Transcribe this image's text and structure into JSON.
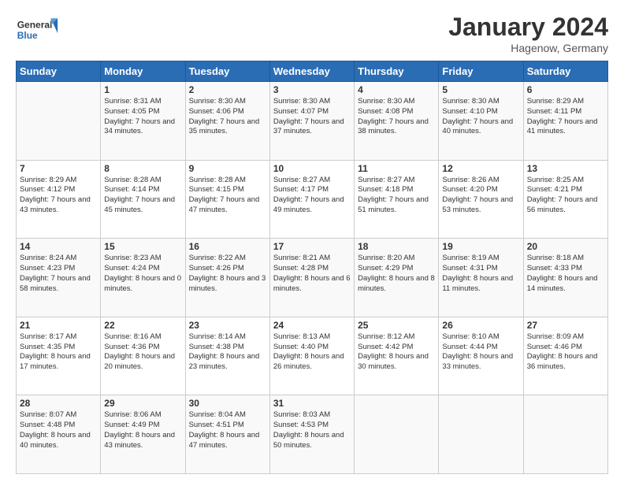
{
  "header": {
    "logo_line1": "General",
    "logo_line2": "Blue",
    "month_title": "January 2024",
    "location": "Hagenow, Germany"
  },
  "days_of_week": [
    "Sunday",
    "Monday",
    "Tuesday",
    "Wednesday",
    "Thursday",
    "Friday",
    "Saturday"
  ],
  "weeks": [
    [
      {
        "day": "",
        "sunrise": "",
        "sunset": "",
        "daylight": ""
      },
      {
        "day": "1",
        "sunrise": "Sunrise: 8:31 AM",
        "sunset": "Sunset: 4:05 PM",
        "daylight": "Daylight: 7 hours and 34 minutes."
      },
      {
        "day": "2",
        "sunrise": "Sunrise: 8:30 AM",
        "sunset": "Sunset: 4:06 PM",
        "daylight": "Daylight: 7 hours and 35 minutes."
      },
      {
        "day": "3",
        "sunrise": "Sunrise: 8:30 AM",
        "sunset": "Sunset: 4:07 PM",
        "daylight": "Daylight: 7 hours and 37 minutes."
      },
      {
        "day": "4",
        "sunrise": "Sunrise: 8:30 AM",
        "sunset": "Sunset: 4:08 PM",
        "daylight": "Daylight: 7 hours and 38 minutes."
      },
      {
        "day": "5",
        "sunrise": "Sunrise: 8:30 AM",
        "sunset": "Sunset: 4:10 PM",
        "daylight": "Daylight: 7 hours and 40 minutes."
      },
      {
        "day": "6",
        "sunrise": "Sunrise: 8:29 AM",
        "sunset": "Sunset: 4:11 PM",
        "daylight": "Daylight: 7 hours and 41 minutes."
      }
    ],
    [
      {
        "day": "7",
        "sunrise": "Sunrise: 8:29 AM",
        "sunset": "Sunset: 4:12 PM",
        "daylight": "Daylight: 7 hours and 43 minutes."
      },
      {
        "day": "8",
        "sunrise": "Sunrise: 8:28 AM",
        "sunset": "Sunset: 4:14 PM",
        "daylight": "Daylight: 7 hours and 45 minutes."
      },
      {
        "day": "9",
        "sunrise": "Sunrise: 8:28 AM",
        "sunset": "Sunset: 4:15 PM",
        "daylight": "Daylight: 7 hours and 47 minutes."
      },
      {
        "day": "10",
        "sunrise": "Sunrise: 8:27 AM",
        "sunset": "Sunset: 4:17 PM",
        "daylight": "Daylight: 7 hours and 49 minutes."
      },
      {
        "day": "11",
        "sunrise": "Sunrise: 8:27 AM",
        "sunset": "Sunset: 4:18 PM",
        "daylight": "Daylight: 7 hours and 51 minutes."
      },
      {
        "day": "12",
        "sunrise": "Sunrise: 8:26 AM",
        "sunset": "Sunset: 4:20 PM",
        "daylight": "Daylight: 7 hours and 53 minutes."
      },
      {
        "day": "13",
        "sunrise": "Sunrise: 8:25 AM",
        "sunset": "Sunset: 4:21 PM",
        "daylight": "Daylight: 7 hours and 56 minutes."
      }
    ],
    [
      {
        "day": "14",
        "sunrise": "Sunrise: 8:24 AM",
        "sunset": "Sunset: 4:23 PM",
        "daylight": "Daylight: 7 hours and 58 minutes."
      },
      {
        "day": "15",
        "sunrise": "Sunrise: 8:23 AM",
        "sunset": "Sunset: 4:24 PM",
        "daylight": "Daylight: 8 hours and 0 minutes."
      },
      {
        "day": "16",
        "sunrise": "Sunrise: 8:22 AM",
        "sunset": "Sunset: 4:26 PM",
        "daylight": "Daylight: 8 hours and 3 minutes."
      },
      {
        "day": "17",
        "sunrise": "Sunrise: 8:21 AM",
        "sunset": "Sunset: 4:28 PM",
        "daylight": "Daylight: 8 hours and 6 minutes."
      },
      {
        "day": "18",
        "sunrise": "Sunrise: 8:20 AM",
        "sunset": "Sunset: 4:29 PM",
        "daylight": "Daylight: 8 hours and 8 minutes."
      },
      {
        "day": "19",
        "sunrise": "Sunrise: 8:19 AM",
        "sunset": "Sunset: 4:31 PM",
        "daylight": "Daylight: 8 hours and 11 minutes."
      },
      {
        "day": "20",
        "sunrise": "Sunrise: 8:18 AM",
        "sunset": "Sunset: 4:33 PM",
        "daylight": "Daylight: 8 hours and 14 minutes."
      }
    ],
    [
      {
        "day": "21",
        "sunrise": "Sunrise: 8:17 AM",
        "sunset": "Sunset: 4:35 PM",
        "daylight": "Daylight: 8 hours and 17 minutes."
      },
      {
        "day": "22",
        "sunrise": "Sunrise: 8:16 AM",
        "sunset": "Sunset: 4:36 PM",
        "daylight": "Daylight: 8 hours and 20 minutes."
      },
      {
        "day": "23",
        "sunrise": "Sunrise: 8:14 AM",
        "sunset": "Sunset: 4:38 PM",
        "daylight": "Daylight: 8 hours and 23 minutes."
      },
      {
        "day": "24",
        "sunrise": "Sunrise: 8:13 AM",
        "sunset": "Sunset: 4:40 PM",
        "daylight": "Daylight: 8 hours and 26 minutes."
      },
      {
        "day": "25",
        "sunrise": "Sunrise: 8:12 AM",
        "sunset": "Sunset: 4:42 PM",
        "daylight": "Daylight: 8 hours and 30 minutes."
      },
      {
        "day": "26",
        "sunrise": "Sunrise: 8:10 AM",
        "sunset": "Sunset: 4:44 PM",
        "daylight": "Daylight: 8 hours and 33 minutes."
      },
      {
        "day": "27",
        "sunrise": "Sunrise: 8:09 AM",
        "sunset": "Sunset: 4:46 PM",
        "daylight": "Daylight: 8 hours and 36 minutes."
      }
    ],
    [
      {
        "day": "28",
        "sunrise": "Sunrise: 8:07 AM",
        "sunset": "Sunset: 4:48 PM",
        "daylight": "Daylight: 8 hours and 40 minutes."
      },
      {
        "day": "29",
        "sunrise": "Sunrise: 8:06 AM",
        "sunset": "Sunset: 4:49 PM",
        "daylight": "Daylight: 8 hours and 43 minutes."
      },
      {
        "day": "30",
        "sunrise": "Sunrise: 8:04 AM",
        "sunset": "Sunset: 4:51 PM",
        "daylight": "Daylight: 8 hours and 47 minutes."
      },
      {
        "day": "31",
        "sunrise": "Sunrise: 8:03 AM",
        "sunset": "Sunset: 4:53 PM",
        "daylight": "Daylight: 8 hours and 50 minutes."
      },
      {
        "day": "",
        "sunrise": "",
        "sunset": "",
        "daylight": ""
      },
      {
        "day": "",
        "sunrise": "",
        "sunset": "",
        "daylight": ""
      },
      {
        "day": "",
        "sunrise": "",
        "sunset": "",
        "daylight": ""
      }
    ]
  ]
}
